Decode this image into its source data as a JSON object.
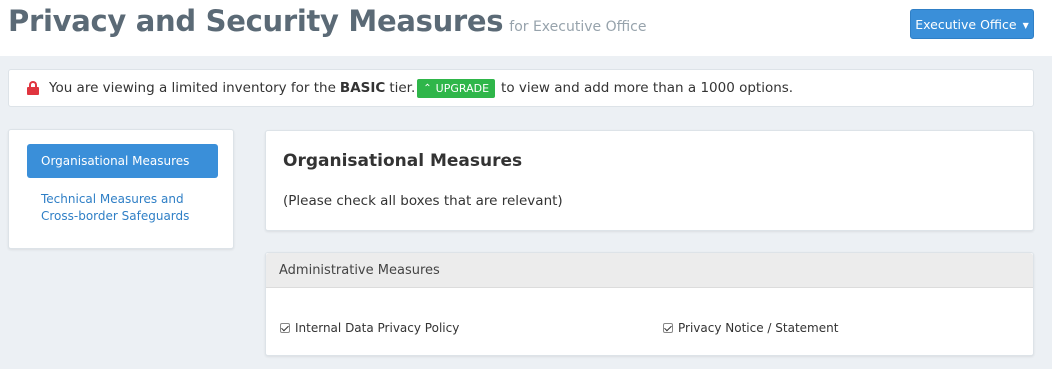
{
  "header": {
    "title": "Privacy and Security Measures",
    "subtitle": "for Executive Office",
    "office_button": "Executive Office"
  },
  "alert": {
    "icon": "lock-icon",
    "text_before": "You are viewing a limited inventory for the",
    "tier": "BASIC",
    "text_tier_after": "tier.",
    "upgrade_label": "UPGRADE",
    "text_after": "to view and add more than a 1000 options."
  },
  "sidebar": {
    "items": [
      {
        "label": "Organisational Measures",
        "active": true
      },
      {
        "label": "Technical Measures and Cross-border Safeguards",
        "active": false
      }
    ]
  },
  "main": {
    "title": "Organisational Measures",
    "hint": "(Please check all boxes that are relevant)"
  },
  "admin": {
    "header": "Administrative Measures",
    "options": [
      {
        "label": "Internal Data Privacy Policy",
        "checked": true
      },
      {
        "label": "Privacy Notice / Statement",
        "checked": true
      }
    ]
  },
  "colors": {
    "accent": "#3a8fd9",
    "upgrade": "#2fb64a",
    "lock": "#e0353f"
  }
}
